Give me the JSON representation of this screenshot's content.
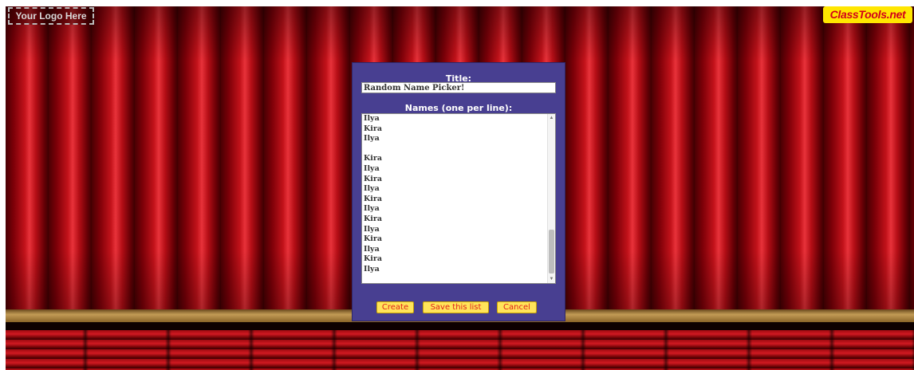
{
  "header": {
    "logo_placeholder": "Your Logo Here",
    "brand": "ClassTools.net"
  },
  "dialog": {
    "title_label": "Title:",
    "title_value": "Random Name Picker!",
    "names_label": "Names (one per line):",
    "names": [
      "Ilya",
      "Kira",
      "Ilya",
      "",
      "Kira",
      "Ilya",
      "Kira",
      "Ilya",
      "Kira",
      "Ilya",
      "Kira",
      "Ilya",
      "Kira",
      "Ilya",
      "Kira",
      "Ilya"
    ],
    "buttons": {
      "create": "Create",
      "save": "Save this list",
      "cancel": "Cancel"
    }
  },
  "colors": {
    "dialog_bg": "#483f91",
    "button_bg": "#ffe45a",
    "button_text": "#e0201a",
    "curtain": "#c2121a"
  },
  "icons": [
    "scroll-up-arrow-icon",
    "scroll-down-arrow-icon"
  ]
}
